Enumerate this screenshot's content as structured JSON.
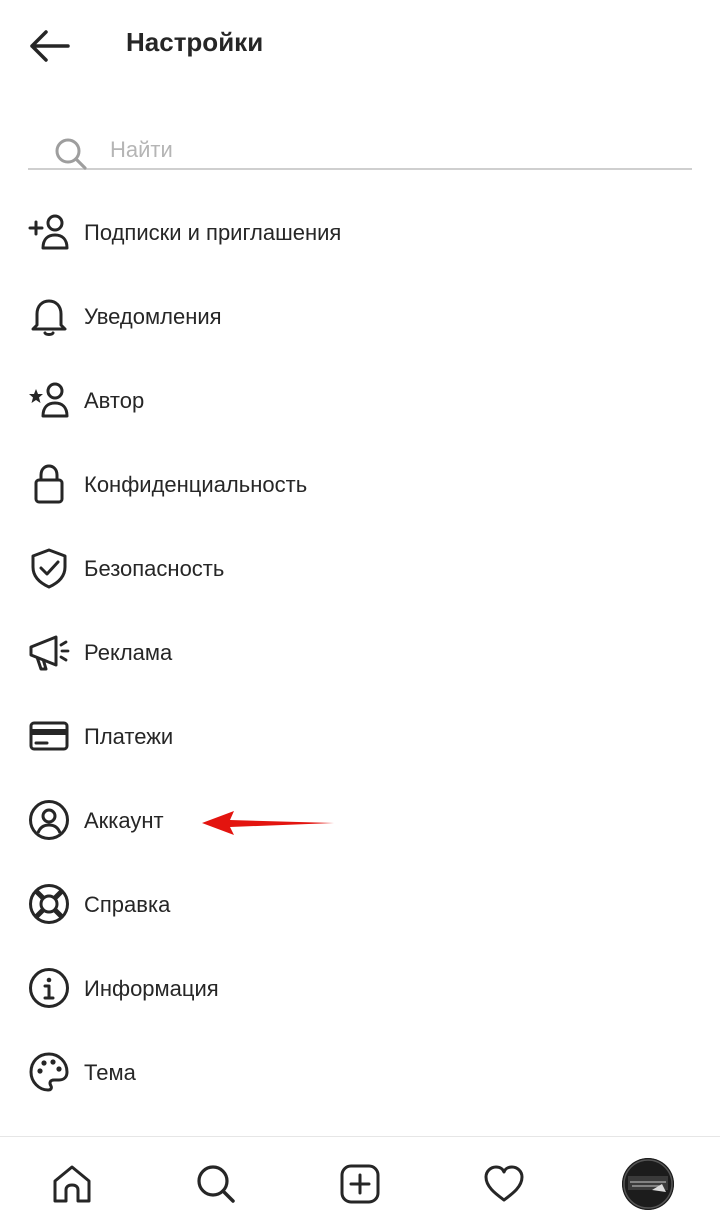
{
  "header": {
    "title": "Настройки",
    "back_icon": "arrow-left-icon"
  },
  "search": {
    "placeholder": "Найти",
    "value": "",
    "icon": "search-icon"
  },
  "menu": {
    "items": [
      {
        "label": "Подписки и приглашения",
        "icon": "person-add-icon"
      },
      {
        "label": "Уведомления",
        "icon": "bell-icon"
      },
      {
        "label": "Автор",
        "icon": "star-person-icon"
      },
      {
        "label": "Конфиденциальность",
        "icon": "lock-icon"
      },
      {
        "label": "Безопасность",
        "icon": "shield-check-icon"
      },
      {
        "label": "Реклама",
        "icon": "megaphone-icon"
      },
      {
        "label": "Платежи",
        "icon": "credit-card-icon"
      },
      {
        "label": "Аккаунт",
        "icon": "account-circle-icon"
      },
      {
        "label": "Справка",
        "icon": "lifebuoy-icon"
      },
      {
        "label": "Информация",
        "icon": "info-icon"
      },
      {
        "label": "Тема",
        "icon": "palette-icon"
      }
    ]
  },
  "annotation": {
    "type": "arrow",
    "color": "#e3140f",
    "points_to": "Аккаунт"
  },
  "bottom_nav": {
    "items": [
      {
        "name": "home",
        "icon": "home-icon"
      },
      {
        "name": "search",
        "icon": "search-icon"
      },
      {
        "name": "create",
        "icon": "plus-square-icon"
      },
      {
        "name": "activity",
        "icon": "heart-icon"
      },
      {
        "name": "profile",
        "icon": "avatar"
      }
    ]
  },
  "colors": {
    "text": "#262626",
    "placeholder": "#b5b5b5",
    "divider": "#cfcfcf",
    "arrow": "#e3140f",
    "background": "#ffffff"
  }
}
